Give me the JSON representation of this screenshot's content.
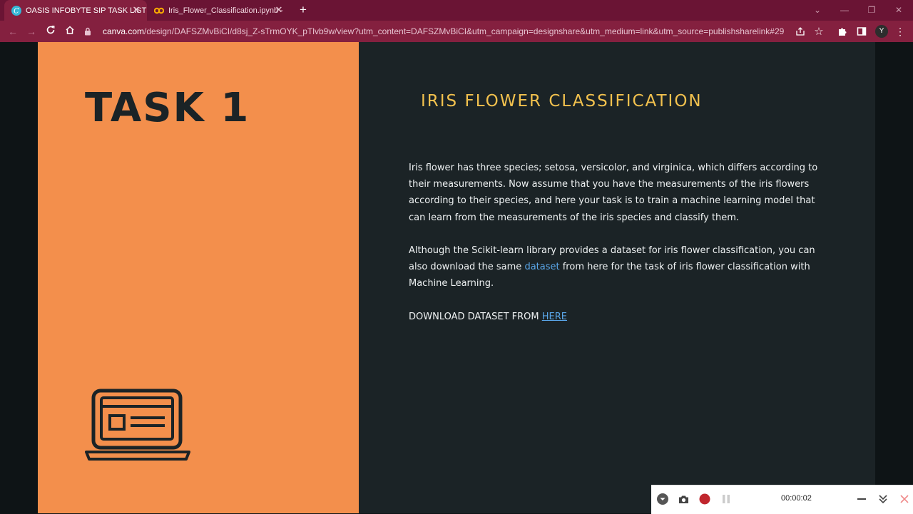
{
  "browser": {
    "tabs": [
      {
        "title": "OASIS INFOBYTE SIP TASK LIST",
        "icon": "canva-icon",
        "active": true
      },
      {
        "title": "Iris_Flower_Classification.ipynb -",
        "icon": "colab-icon",
        "active": false
      }
    ],
    "new_tab_label": "+",
    "close_glyph": "✕",
    "url_host": "canva.com",
    "url_path": "/design/DAFSZMvBiCI/d8sj_Z-sTrmOYK_pTlvb9w/view?utm_content=DAFSZMvBiCI&utm_campaign=designshare&utm_medium=link&utm_source=publishsharelink#29",
    "profile_initial": "Y",
    "accent_color": "#84203f"
  },
  "slide": {
    "task_title": "TASK 1",
    "heading": "IRIS FLOWER CLASSIFICATION",
    "paragraph1": "Iris flower has three species; setosa, versicolor, and virginica, which differs according to their measurements. Now assume that you have the measurements of the iris flowers according to their species, and here your task is to train a machine learning model that can learn from the measurements of the iris species and classify them.",
    "paragraph2_before": "Although the Scikit-learn library provides a dataset for iris flower classification, you can also download the same ",
    "paragraph2_link": "dataset",
    "paragraph2_after": " from here for the task of iris flower classification with Machine Learning.",
    "download_text": "DOWNLOAD DATASET FROM ",
    "download_link": "HERE",
    "left_color": "#f38f4c",
    "right_color": "#1b2326",
    "heading_color": "#f2c14e",
    "icon": "laptop-icon"
  },
  "recorder": {
    "timer": "00:00:02"
  }
}
